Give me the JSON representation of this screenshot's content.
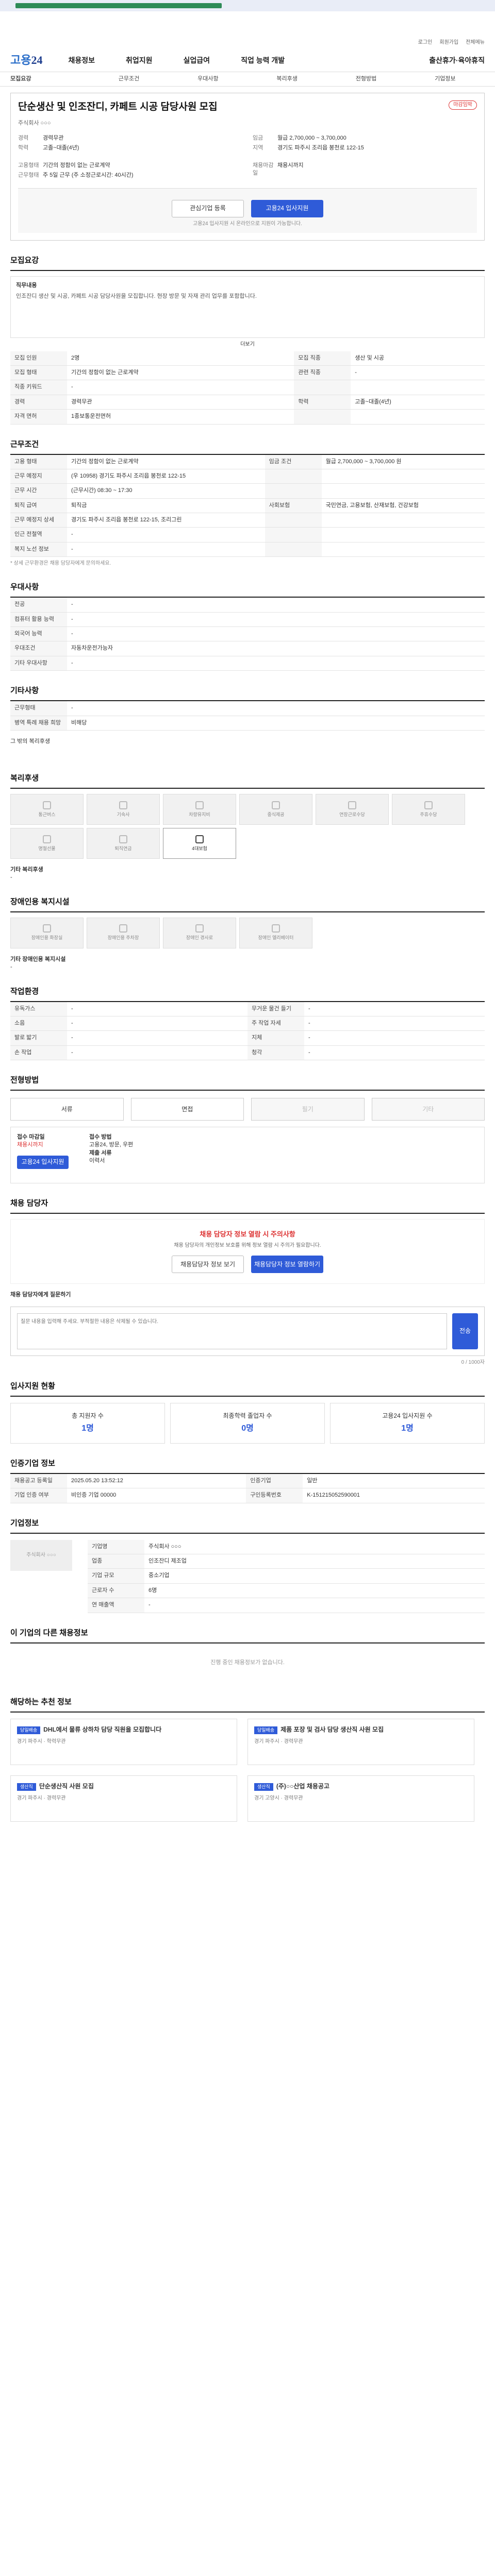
{
  "notice": "고용24 고용노동부 정보 안내 서비스입니다",
  "util": [
    "로그인",
    "회원가입",
    "전체메뉴"
  ],
  "logo": {
    "a": "고용",
    "b": "24"
  },
  "gnb": [
    "채용정보",
    "취업지원",
    "실업급여",
    "직업 능력 개발",
    "출산휴가·육아휴직"
  ],
  "tabs": [
    "모집요강",
    "근무조건",
    "우대사항",
    "복리후생",
    "전형방법",
    "기업정보"
  ],
  "job": {
    "title": "단순생산 및 인조잔디, 카페트 시공 담당사원 모집",
    "badge": "마감임박",
    "company": "주식회사 ○○○",
    "k1": "경력",
    "v1": "경력무관",
    "k2": "학력",
    "v2": "고졸~대졸(4년)",
    "k3": "임금",
    "v3": "월급 2,700,000 ~ 3,700,000",
    "k4": "지역",
    "v4": "경기도 파주시 조리읍 봉천로 122-15",
    "emp": "고용형태",
    "empv": "기간의 정함이 없는 근로계약",
    "wt": "근무형태",
    "wtv": "주 5일 근무 (주 소정근로시간: 40시간)",
    "dl": "채용마감일",
    "dlv": "채용시까지",
    "b1": "관심기업 등록",
    "b2": "고용24 입사지원",
    "note": "고용24 입사지원 시 온라인으로 지원이 가능합니다."
  },
  "recruit": {
    "h": "모집요강",
    "jobh": "직무내용",
    "jobt": "인조잔디 생산 및 시공, 카페트 시공 담당사원을 모집합니다. 현장 방문 및 자재 관리 업무를 포함합니다.",
    "more": "더보기",
    "rows": [
      [
        "모집 인원",
        "2명",
        "모집 직종",
        "생산 및 시공"
      ],
      [
        "모집 형태",
        "기간의 정함이 없는 근로계약",
        "관련 직종",
        "-"
      ],
      [
        "직종 키워드",
        "-",
        "",
        ""
      ],
      [
        "경력",
        "경력무관",
        "학력",
        "고졸~대졸(4년)"
      ],
      [
        "자격 면허",
        "1종보통운전면허",
        "",
        ""
      ]
    ]
  },
  "cond": {
    "h": "근무조건",
    "rows": [
      [
        "고용 형태",
        "기간의 정함이 없는 근로계약",
        "임금 조건",
        "월급 2,700,000 ~ 3,700,000 원"
      ],
      [
        "근무 예정지",
        "(우 10958) 경기도 파주시 조리읍 봉천로 122-15",
        "",
        ""
      ],
      [
        "근무 시간",
        "(근무시간) 08:30 ~ 17:30",
        "",
        ""
      ],
      [
        "퇴직 급여",
        "퇴직금",
        "사회보험",
        "국민연금, 고용보험, 산재보험, 건강보험"
      ],
      [
        "근무 예정지 상세",
        "경기도 파주시 조리읍 봉천로 122-15, 조리그린",
        "",
        ""
      ],
      [
        "인근 전철역",
        "-",
        "",
        ""
      ],
      [
        "복지 노선 정보",
        "-",
        "",
        ""
      ]
    ],
    "note": "* 상세 근무환경은 채용 담당자에게 문의하세요."
  },
  "pref": {
    "h": "우대사항",
    "rows": [
      [
        "전공",
        "-"
      ],
      [
        "컴퓨터 활용 능력",
        "-"
      ],
      [
        "외국어 능력",
        "-"
      ],
      [
        "우대조건",
        "자동차운전가능자"
      ],
      [
        "기타 우대사항",
        "-"
      ]
    ]
  },
  "etc": {
    "h": "기타사항",
    "rows": [
      [
        "근무형태",
        "-"
      ],
      [
        "병역 특례 채용 희망",
        "비해당"
      ]
    ],
    "extra": "그 밖의 복리후생"
  },
  "welfare": {
    "h": "복리후생",
    "items": [
      "통근버스",
      "기숙사",
      "차량유지비",
      "중식제공",
      "연장근로수당",
      "주휴수당",
      "명절선물",
      "퇴직연금",
      "4대보험"
    ],
    "other": "기타 복리후생",
    "otherv": "-"
  },
  "disab": {
    "h": "장애인용 복지시설",
    "items": [
      "장애인용 화장실",
      "장애인용 주차장",
      "장애인 경사로",
      "장애인 엘리베이터"
    ],
    "other": "기타 장애인용 복지시설",
    "otherv": "-"
  },
  "env": {
    "h": "작업환경",
    "rows": [
      [
        "유독가스",
        "-",
        "무거운 물건 들기",
        "-"
      ],
      [
        "소음",
        "-",
        "주 작업 자세",
        "-"
      ],
      [
        "발로 밟기",
        "-",
        "지체",
        "-"
      ],
      [
        "손 작업",
        "-",
        "청각",
        "-"
      ]
    ]
  },
  "sel": {
    "h": "전형방법",
    "opts": [
      "서류",
      "면접",
      "필기",
      "기타"
    ],
    "a": "접수 마감일",
    "av": "채용시까지",
    "b": "접수 방법",
    "bv": "고용24, 방문, 우편",
    "c": "제출 서류",
    "cv": "이력서",
    "btn": "고용24 입사지원"
  },
  "contact": {
    "h": "채용 담당자",
    "wt": "채용 담당자 정보 열람 시 주의사항",
    "wd": "채용 담당자의 개인정보 보호를 위해 정보 열람 시 주의가 필요합니다.",
    "b1": "채용담당자 정보 보기",
    "b2": "채용담당자 정보 열람하기",
    "qh": "채용 담당자에게 질문하기",
    "qp": "질문 내용을 입력해 주세요. 부적절한 내용은 삭제될 수 있습니다.",
    "send": "전송",
    "qn": "0 / 1000자"
  },
  "stats": {
    "h": "입사지원 현황",
    "more": "더보기",
    "items": [
      [
        "총 지원자 수",
        "1명"
      ],
      [
        "최종학력 졸업자 수",
        "0명"
      ],
      [
        "고용24 입사지원 수",
        "1명"
      ]
    ]
  },
  "info": {
    "h": "인증기업 정보",
    "rows": [
      [
        "채용공고 등록일",
        "2025.05.20 13:52:12",
        "인증기업",
        "일반"
      ],
      [
        "기업 인증 여부",
        "비인증 기업 00000",
        "구인등록번호",
        "K-151215052590001"
      ]
    ]
  },
  "corp": {
    "h": "기업정보",
    "name": "주식회사 ○○○",
    "rows": [
      [
        "기업명",
        "주식회사 ○○○"
      ],
      [
        "업종",
        "인조잔디 제조업"
      ],
      [
        "기업 규모",
        "중소기업"
      ],
      [
        "근로자 수",
        "6명"
      ],
      [
        "연 매출액",
        "-"
      ]
    ]
  },
  "similar": {
    "h": "이 기업의 다른 채용정보",
    "empty": "진행 중인 채용정보가 없습니다."
  },
  "more": {
    "h": "해당하는 추천 정보",
    "cards": [
      [
        "당일배송",
        "DHL에서 물류 상하차 담당 직원을 모집합니다",
        "경기 파주시",
        "학력무관"
      ],
      [
        "당일배송",
        "제품 포장 및 검사 담당 생산직 사원 모집",
        "경기 파주시",
        "경력무관"
      ],
      [
        "생산직",
        "단순생산직 사원 모집",
        "경기 파주시",
        "경력무관"
      ],
      [
        "생산직",
        "(주)○○산업 채용공고",
        "경기 고양시",
        "경력무관"
      ]
    ]
  }
}
